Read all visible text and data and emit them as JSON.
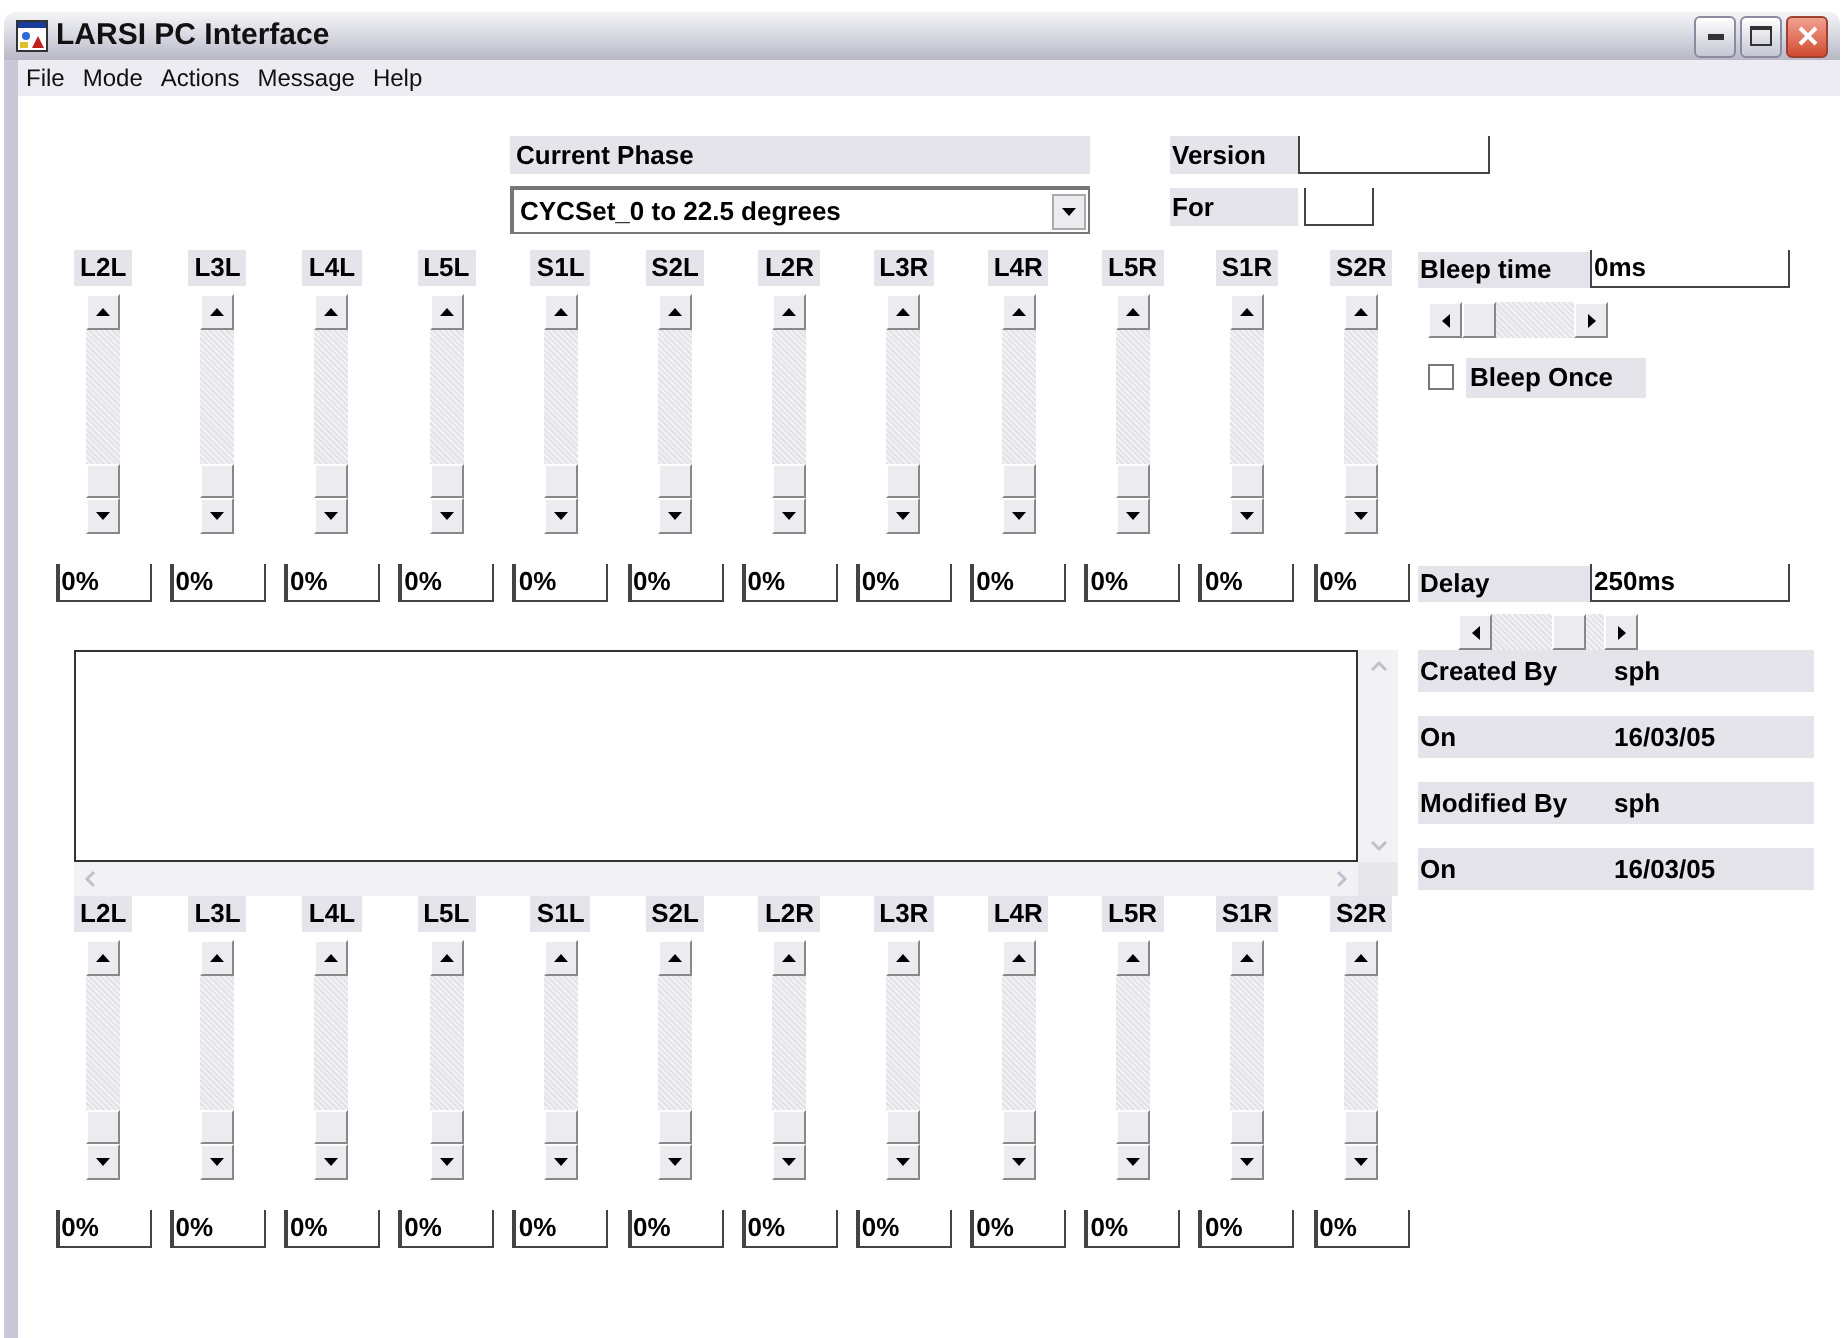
{
  "window": {
    "title": "LARSI PC Interface"
  },
  "menu": [
    "File",
    "Mode",
    "Actions",
    "Message",
    "Help"
  ],
  "current_phase": {
    "label": "Current Phase",
    "value": "CYCSet_0 to 22.5 degrees"
  },
  "version": {
    "label": "Version"
  },
  "for": {
    "label": "For"
  },
  "upper_bank": [
    {
      "label": "L2L",
      "level": 0,
      "reading": "0%"
    },
    {
      "label": "L3L",
      "level": 0,
      "reading": "0%"
    },
    {
      "label": "L4L",
      "level": 0,
      "reading": "0%"
    },
    {
      "label": "L5L",
      "level": 0,
      "reading": "0%"
    },
    {
      "label": "S1L",
      "level": 0,
      "reading": "0%"
    },
    {
      "label": "S2L",
      "level": 0,
      "reading": "0%"
    },
    {
      "label": "L2R",
      "level": 0,
      "reading": "0%"
    },
    {
      "label": "L3R",
      "level": 0,
      "reading": "0%"
    },
    {
      "label": "L4R",
      "level": 0,
      "reading": "0%"
    },
    {
      "label": "L5R",
      "level": 0,
      "reading": "0%"
    },
    {
      "label": "S1R",
      "level": 0,
      "reading": "0%"
    },
    {
      "label": "S2R",
      "level": 0,
      "reading": "0%"
    }
  ],
  "bleep_time": {
    "label": "Bleep time",
    "value": "0ms",
    "level": 0
  },
  "bleep_once": {
    "label": "Bleep Once",
    "checked": false
  },
  "delay": {
    "label": "Delay",
    "value": "250ms",
    "level": 0.78
  },
  "info": [
    {
      "label": "Created By",
      "value": "sph"
    },
    {
      "label": "On",
      "value": "16/03/05"
    },
    {
      "label": "Modified By",
      "value": "sph"
    },
    {
      "label": "On",
      "value": "16/03/05"
    }
  ],
  "lower_bank": [
    {
      "label": "L2L",
      "level": 0,
      "reading": "0%"
    },
    {
      "label": "L3L",
      "level": 0,
      "reading": "0%"
    },
    {
      "label": "L4L",
      "level": 0,
      "reading": "0%"
    },
    {
      "label": "L5L",
      "level": 0,
      "reading": "0%"
    },
    {
      "label": "S1L",
      "level": 0,
      "reading": "0%"
    },
    {
      "label": "S2L",
      "level": 0,
      "reading": "0%"
    },
    {
      "label": "L2R",
      "level": 0,
      "reading": "0%"
    },
    {
      "label": "L3R",
      "level": 0,
      "reading": "0%"
    },
    {
      "label": "L4R",
      "level": 0,
      "reading": "0%"
    },
    {
      "label": "L5R",
      "level": 0,
      "reading": "0%"
    },
    {
      "label": "S1R",
      "level": 0,
      "reading": "0%"
    },
    {
      "label": "S2R",
      "level": 0,
      "reading": "0%"
    }
  ]
}
